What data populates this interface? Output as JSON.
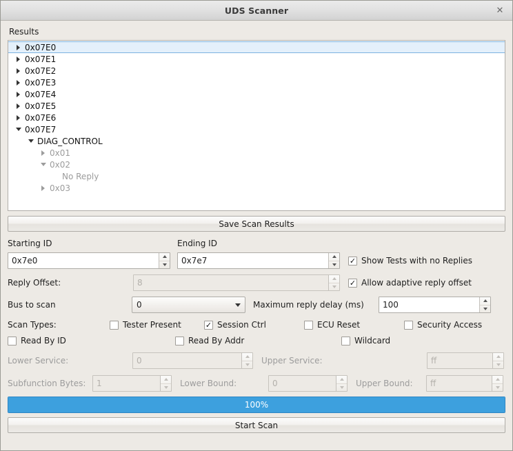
{
  "window": {
    "title": "UDS Scanner",
    "close_icon": "close-icon"
  },
  "results": {
    "label": "Results",
    "tree": [
      {
        "label": "0x07E0",
        "depth": 0,
        "arrow": "right",
        "selected": true,
        "dim": false
      },
      {
        "label": "0x07E1",
        "depth": 0,
        "arrow": "right",
        "selected": false,
        "dim": false
      },
      {
        "label": "0x07E2",
        "depth": 0,
        "arrow": "right",
        "selected": false,
        "dim": false
      },
      {
        "label": "0x07E3",
        "depth": 0,
        "arrow": "right",
        "selected": false,
        "dim": false
      },
      {
        "label": "0x07E4",
        "depth": 0,
        "arrow": "right",
        "selected": false,
        "dim": false
      },
      {
        "label": "0x07E5",
        "depth": 0,
        "arrow": "right",
        "selected": false,
        "dim": false
      },
      {
        "label": "0x07E6",
        "depth": 0,
        "arrow": "right",
        "selected": false,
        "dim": false
      },
      {
        "label": "0x07E7",
        "depth": 0,
        "arrow": "down",
        "selected": false,
        "dim": false
      },
      {
        "label": "DIAG_CONTROL",
        "depth": 1,
        "arrow": "down",
        "selected": false,
        "dim": false
      },
      {
        "label": "0x01",
        "depth": 2,
        "arrow": "right",
        "selected": false,
        "dim": true
      },
      {
        "label": "0x02",
        "depth": 2,
        "arrow": "down",
        "selected": false,
        "dim": true
      },
      {
        "label": "No Reply",
        "depth": 3,
        "arrow": "none",
        "selected": false,
        "dim": true
      },
      {
        "label": "0x03",
        "depth": 2,
        "arrow": "right",
        "selected": false,
        "dim": true
      }
    ]
  },
  "save_button": {
    "label": "Save Scan Results"
  },
  "id_range": {
    "starting_label": "Starting ID",
    "starting_value": "0x7e0",
    "ending_label": "Ending ID",
    "ending_value": "0x7e7",
    "show_no_replies": {
      "label": "Show Tests with no Replies",
      "checked": true
    }
  },
  "reply_offset": {
    "label": "Reply Offset:",
    "value": "8",
    "disabled": true,
    "adaptive": {
      "label": "Allow adaptive reply offset",
      "checked": true
    }
  },
  "bus": {
    "label": "Bus to scan",
    "value": "0",
    "delay_label": "Maximum reply delay (ms)",
    "delay_value": "100"
  },
  "scan_types": {
    "label": "Scan Types:",
    "row1": [
      {
        "label": "Tester Present",
        "checked": false
      },
      {
        "label": "Session Ctrl",
        "checked": true
      },
      {
        "label": "ECU Reset",
        "checked": false
      },
      {
        "label": "Security Access",
        "checked": false
      }
    ],
    "row2": [
      {
        "label": "Read By ID",
        "checked": false
      },
      {
        "label": "Read By Addr",
        "checked": false
      },
      {
        "label": "Wildcard",
        "checked": false
      }
    ]
  },
  "services": {
    "lower_service_label": "Lower Service:",
    "lower_service_value": "0",
    "upper_service_label": "Upper Service:",
    "upper_service_value": "ff",
    "subfunction_label": "Subfunction Bytes:",
    "subfunction_value": "1",
    "lower_bound_label": "Lower Bound:",
    "lower_bound_value": "0",
    "upper_bound_label": "Upper Bound:",
    "upper_bound_value": "ff"
  },
  "progress": {
    "label": "100%",
    "percent": 100,
    "color": "#3da0de"
  },
  "start_button": {
    "label": "Start Scan"
  }
}
